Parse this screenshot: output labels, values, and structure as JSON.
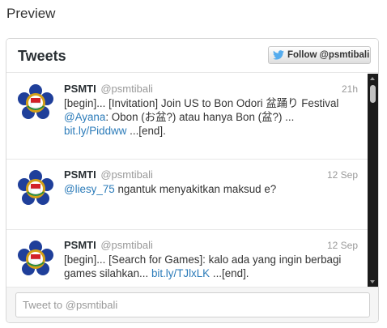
{
  "page": {
    "heading": "Preview"
  },
  "widget": {
    "title": "Tweets",
    "follow_button": {
      "label": "Follow @psmtibali",
      "icon": "twitter-bird-icon",
      "icon_color": "#55acee"
    },
    "tweet_box_placeholder": "Tweet to @psmtibali"
  },
  "colors": {
    "link": "#2b7bb9",
    "muted": "#999999",
    "scrollbar": "#1b1b1b"
  },
  "tweets": [
    {
      "name": "PSMTI",
      "handle": "@psmtibali",
      "time": "21h",
      "t1": "[begin]... [Invitation] Join US to Bon Odori 盆踊り Festival ",
      "mention": "@Ayana",
      "t2": ": Obon (お盆?) atau hanya Bon (盆?) ... ",
      "link": "bit.ly/Piddww",
      "t3": " ...[end]."
    },
    {
      "name": "PSMTI",
      "handle": "@psmtibali",
      "time": "12 Sep",
      "mention": "@liesy_75",
      "t1": " ngantuk menyakitkan maksud e?"
    },
    {
      "name": "PSMTI",
      "handle": "@psmtibali",
      "time": "12 Sep",
      "t1": "[begin]... [Search for Games]: kalo ada yang ingin berbagi games silahkan... ",
      "link": "bit.ly/TJlxLK",
      "t2": " ...[end]."
    }
  ]
}
